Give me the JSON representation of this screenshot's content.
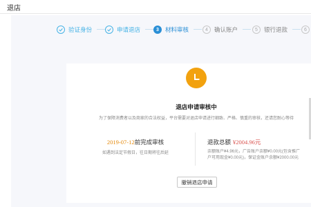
{
  "header": {
    "title": "退店"
  },
  "steps": [
    {
      "index": "1",
      "label": "验证身份",
      "state": "done"
    },
    {
      "index": "2",
      "label": "申请退店",
      "state": "done"
    },
    {
      "index": "3",
      "label": "材料审核",
      "state": "current"
    },
    {
      "index": "4",
      "label": "确认账户",
      "state": "pending"
    },
    {
      "index": "5",
      "label": "银行退款",
      "state": "pending"
    },
    {
      "index": "6",
      "label": "",
      "state": "pending"
    }
  ],
  "card": {
    "status_icon": "clock-icon",
    "title": "退店申请审核中",
    "description": "为了保障消费者以及商家的合法权益，平台需要对退店申请进行细致、严格、慎重的审核，还请您耐心等待",
    "deadline": {
      "date": "2019-07-12",
      "suffix": "前完成审核",
      "note": "如遇到法定节假日，往日期将往后延"
    },
    "refund": {
      "label": "退款总额",
      "amount": "¥2004.96元",
      "detail_line1": "余额账户¥4.96元，广告账户余额¥0.00元(包含推广",
      "detail_line2": "户可用现金¥0.00元)，保证金账户余额¥2000.00元"
    },
    "cancel_button": "撤销退店申请"
  },
  "colors": {
    "accent": "#2a8fd6",
    "done": "#46b3e6",
    "warning_icon": "#f2a20f",
    "deadline": "#e58a0c",
    "amount": "#d9534f"
  }
}
